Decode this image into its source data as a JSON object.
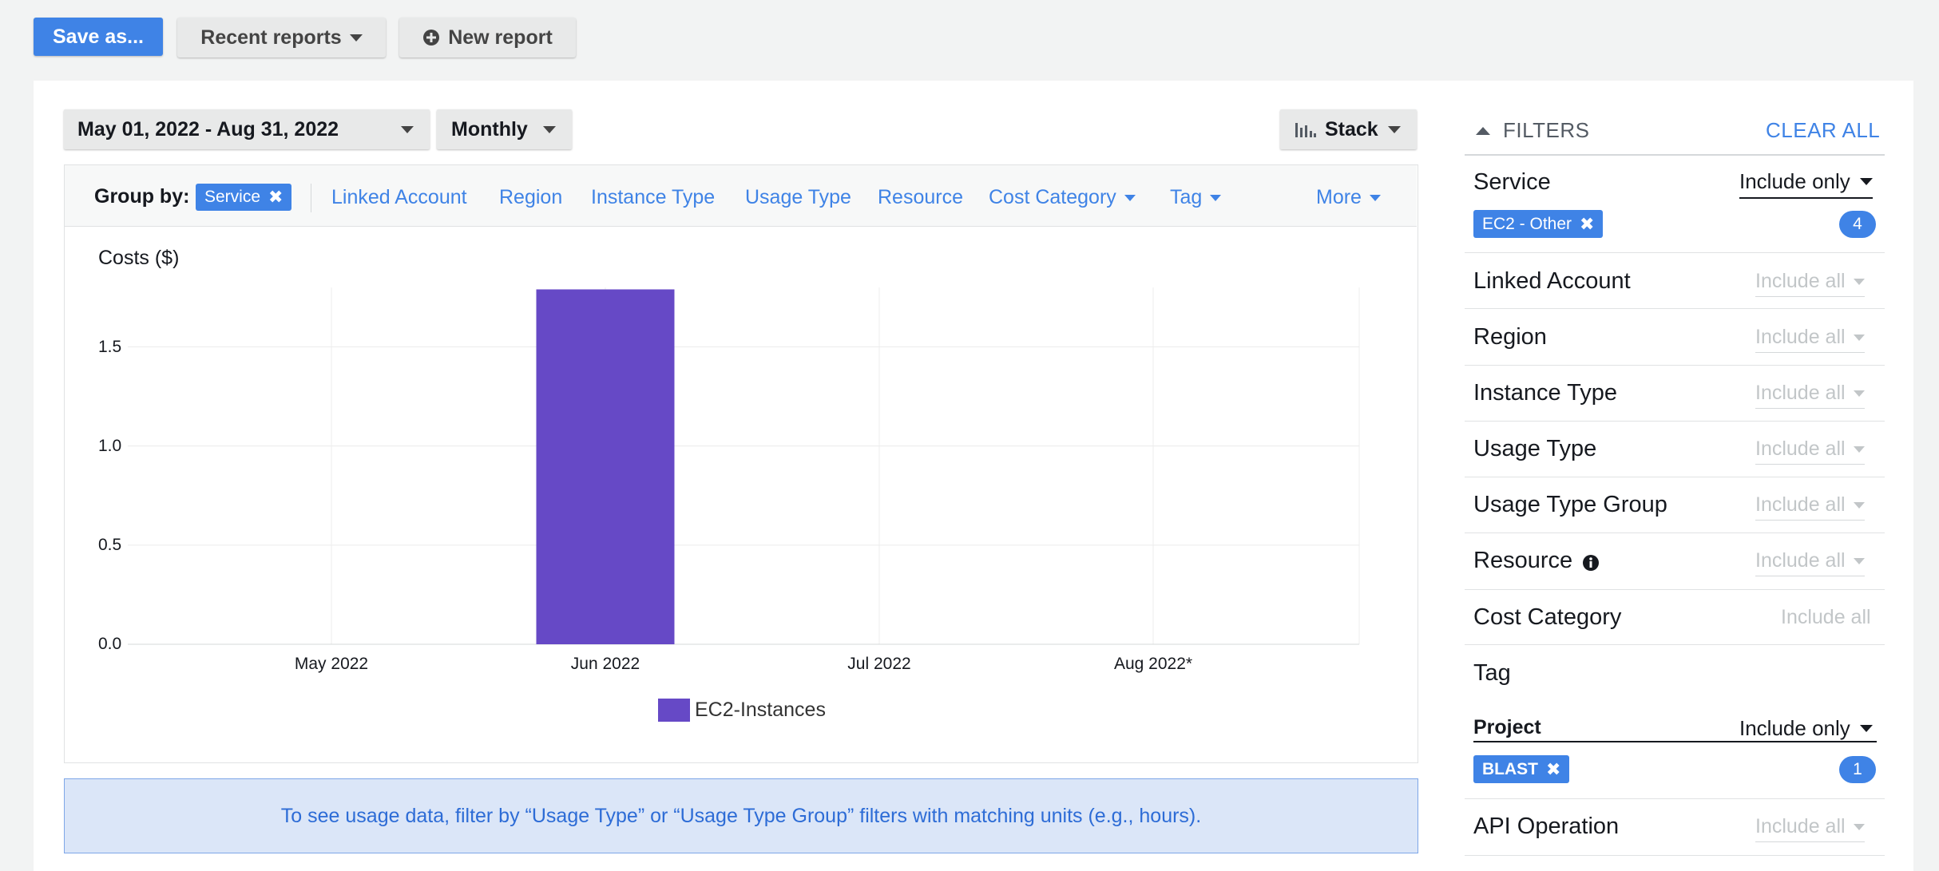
{
  "toolbar": {
    "save_as_label": "Save as...",
    "recent_reports_label": "Recent reports",
    "new_report_label": "New report"
  },
  "report": {
    "date_range": "May 01, 2022 - Aug 31, 2022",
    "granularity": "Monthly",
    "chart_style": "Stack",
    "group_by_label": "Group by:",
    "group_by_chip": "Service",
    "group_by_options": [
      "Linked Account",
      "Region",
      "Instance Type",
      "Usage Type",
      "Resource",
      "Cost Category",
      "Tag",
      "More"
    ]
  },
  "chart_data": {
    "type": "bar",
    "ylabel": "Costs ($)",
    "categories": [
      "May 2022",
      "Jun 2022",
      "Jul 2022",
      "Aug 2022*"
    ],
    "series": [
      {
        "name": "EC2-Instances",
        "values": [
          0,
          1.79,
          0,
          0
        ],
        "color": "#6649c6"
      }
    ],
    "ylim": [
      0,
      1.8
    ],
    "yticks": [
      "0.0",
      "0.5",
      "1.0",
      "1.5"
    ],
    "grid": true,
    "legend_position": "bottom-center"
  },
  "info_message": "To see usage data, filter by “Usage Type” or “Usage Type Group” filters with matching units (e.g., hours).",
  "filters": {
    "title": "FILTERS",
    "clear_all": "CLEAR ALL",
    "service": {
      "label": "Service",
      "mode": "Include only",
      "chip": "EC2 - Other",
      "count": "4"
    },
    "linked_account": {
      "label": "Linked Account",
      "mode": "Include all"
    },
    "region": {
      "label": "Region",
      "mode": "Include all"
    },
    "instance_type": {
      "label": "Instance Type",
      "mode": "Include all"
    },
    "usage_type": {
      "label": "Usage Type",
      "mode": "Include all"
    },
    "usage_type_group": {
      "label": "Usage Type Group",
      "mode": "Include all"
    },
    "resource": {
      "label": "Resource",
      "mode": "Include all"
    },
    "cost_category": {
      "label": "Cost Category",
      "mode": "Include all"
    },
    "tag": {
      "label": "Tag"
    },
    "project": {
      "label": "Project",
      "mode": "Include only",
      "chip": "BLAST",
      "count": "1"
    },
    "api_operation": {
      "label": "API Operation",
      "mode": "Include all"
    }
  },
  "colors": {
    "accent": "#3f83e6",
    "bar": "#6649c6",
    "info_bg": "#dbe6f8"
  },
  "icons": [
    "plus-circle-icon",
    "caret-down-icon",
    "bar-chart-icon",
    "close-icon",
    "caret-up-icon",
    "info-icon"
  ]
}
